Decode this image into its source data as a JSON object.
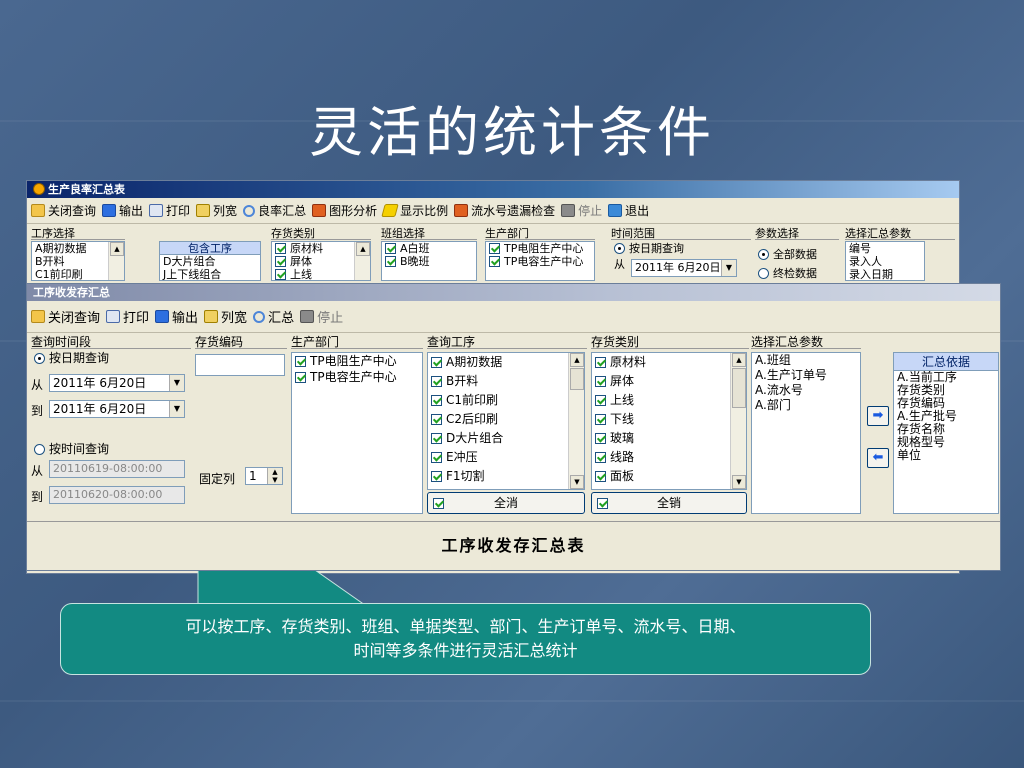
{
  "slide": {
    "title": "灵活的统计条件",
    "callout_line1": "可以按工序、存货类别、班组、单据类型、部门、生产订单号、流水号、日期、",
    "callout_line2": "时间等多条件进行灵活汇总统计"
  },
  "back_window": {
    "title": "生产良率汇总表",
    "toolbar": [
      {
        "icon": "folder-icon",
        "label": "关闭查询"
      },
      {
        "icon": "export-icon",
        "label": "输出"
      },
      {
        "icon": "print-icon",
        "label": "打印"
      },
      {
        "icon": "columns-icon",
        "label": "列宽"
      },
      {
        "icon": "search-icon",
        "label": "良率汇总"
      },
      {
        "icon": "paint-icon",
        "label": "图形分析"
      },
      {
        "icon": "lightning-icon",
        "label": "显示比例"
      },
      {
        "icon": "paint-icon",
        "label": "流水号遗漏检查"
      },
      {
        "icon": "stop-icon",
        "label": "停止"
      },
      {
        "icon": "exit-icon",
        "label": "退出"
      }
    ],
    "groups": {
      "process_label": "工序选择",
      "process_items": [
        "A期初数据",
        "B开料",
        "C1前印刷"
      ],
      "include_label": "包含工序",
      "include_items": [
        "D大片组合",
        "J上下线组合"
      ],
      "inventory_label": "存货类别",
      "inventory_items": [
        "原材料",
        "屏体",
        "上线"
      ],
      "team_label": "班组选择",
      "team_items": [
        "A白班",
        "B晚班"
      ],
      "dept_label": "生产部门",
      "dept_items": [
        "TP电阻生产中心",
        "TP电容生产中心"
      ],
      "time_label": "时间范围",
      "time_radio": "按日期查询",
      "time_from": "从",
      "time_date": "2011年  6月20日",
      "param_label": "参数选择",
      "param_all": "全部数据",
      "param_check": "终检数据",
      "summary_label": "选择汇总参数",
      "summary_items": [
        "编号",
        "录入人",
        "录入日期"
      ]
    }
  },
  "front_window": {
    "title": "工序收发存汇总",
    "toolbar": [
      {
        "icon": "folder-icon",
        "label": "关闭查询"
      },
      {
        "icon": "print-icon",
        "label": "打印"
      },
      {
        "icon": "export-icon",
        "label": "输出"
      },
      {
        "icon": "columns-icon",
        "label": "列宽"
      },
      {
        "icon": "search-icon",
        "label": "汇总"
      },
      {
        "icon": "stop-icon",
        "label": "停止"
      }
    ],
    "query_time": {
      "label": "查询时间段",
      "by_date": "按日期查询",
      "from": "从",
      "to": "到",
      "date_from": "2011年  6月20日",
      "date_to": "2011年  6月20日",
      "by_time": "按时间查询",
      "time_from": "20110619-08:00:00",
      "time_to": "20110620-08:00:00"
    },
    "inventory_code": {
      "label": "存货编码",
      "fixed_col_label": "固定列",
      "fixed_col_value": "1"
    },
    "dept": {
      "label": "生产部门",
      "items": [
        "TP电阻生产中心",
        "TP电容生产中心"
      ]
    },
    "process": {
      "label": "查询工序",
      "items": [
        "A期初数据",
        "B开料",
        "C1前印刷",
        "C2后印刷",
        "D大片组合",
        "E冲压",
        "F1切割"
      ],
      "cancel_all": "全消"
    },
    "inventory_type": {
      "label": "存货类别",
      "items": [
        "原材料",
        "屏体",
        "上线",
        "下线",
        "玻璃",
        "线路",
        "面板"
      ],
      "cancel_all": "全销"
    },
    "summary_params": {
      "label": "选择汇总参数",
      "items": [
        "A.班组",
        "A.生产订单号",
        "A.流水号",
        "A.部门"
      ]
    },
    "summary_basis": {
      "label": "汇总依据",
      "items": [
        "A.当前工序",
        "存货类别",
        "存货编码",
        "A.生产批号",
        "存货名称",
        "规格型号",
        "单位"
      ]
    },
    "report_title": "工序收发存汇总表"
  },
  "colors": {
    "background": "#42618a",
    "callout": "#128a82",
    "window": "#ece9d8",
    "titlebar_active": "#0a246a"
  }
}
